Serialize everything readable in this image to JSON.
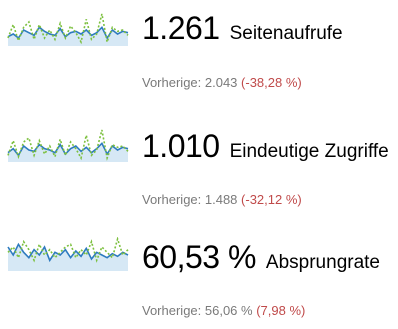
{
  "metrics": [
    {
      "value": "1.261",
      "label": "Seitenaufrufe",
      "prev_prefix": "Vorherige: 2.043",
      "prev_change": "(-38,28 %)",
      "current_series": [
        7,
        9,
        6,
        12,
        10,
        8,
        14,
        11,
        9,
        8,
        13,
        7,
        10,
        11,
        9,
        12,
        8,
        10,
        14,
        6,
        12,
        9,
        11,
        10
      ],
      "previous_series": [
        6,
        16,
        4,
        14,
        18,
        5,
        16,
        6,
        12,
        5,
        17,
        6,
        15,
        10,
        3,
        20,
        5,
        9,
        24,
        3,
        14,
        11,
        12,
        8
      ]
    },
    {
      "value": "1.010",
      "label": "Eindeutige Zugriffe",
      "prev_prefix": "Vorherige: 1.488",
      "prev_change": "(-32,12 %)",
      "current_series": [
        7,
        10,
        5,
        12,
        9,
        8,
        13,
        10,
        9,
        7,
        13,
        6,
        10,
        12,
        8,
        11,
        7,
        10,
        14,
        6,
        12,
        9,
        11,
        10
      ],
      "previous_series": [
        5,
        16,
        4,
        15,
        18,
        5,
        16,
        6,
        12,
        4,
        17,
        5,
        15,
        10,
        3,
        20,
        5,
        9,
        24,
        3,
        13,
        11,
        12,
        8
      ]
    },
    {
      "value": "60,53 %",
      "label": "Absprungrate",
      "prev_prefix": "Vorherige: 56,06 %",
      "prev_change": "(7,98 %)",
      "current_series": [
        18,
        12,
        20,
        14,
        10,
        16,
        12,
        18,
        8,
        14,
        12,
        16,
        10,
        15,
        11,
        17,
        9,
        14,
        12,
        10,
        13,
        11,
        14,
        12
      ],
      "previous_series": [
        14,
        18,
        10,
        22,
        16,
        8,
        20,
        12,
        16,
        10,
        14,
        18,
        20,
        10,
        16,
        12,
        22,
        8,
        18,
        14,
        10,
        24,
        12,
        16
      ]
    }
  ]
}
